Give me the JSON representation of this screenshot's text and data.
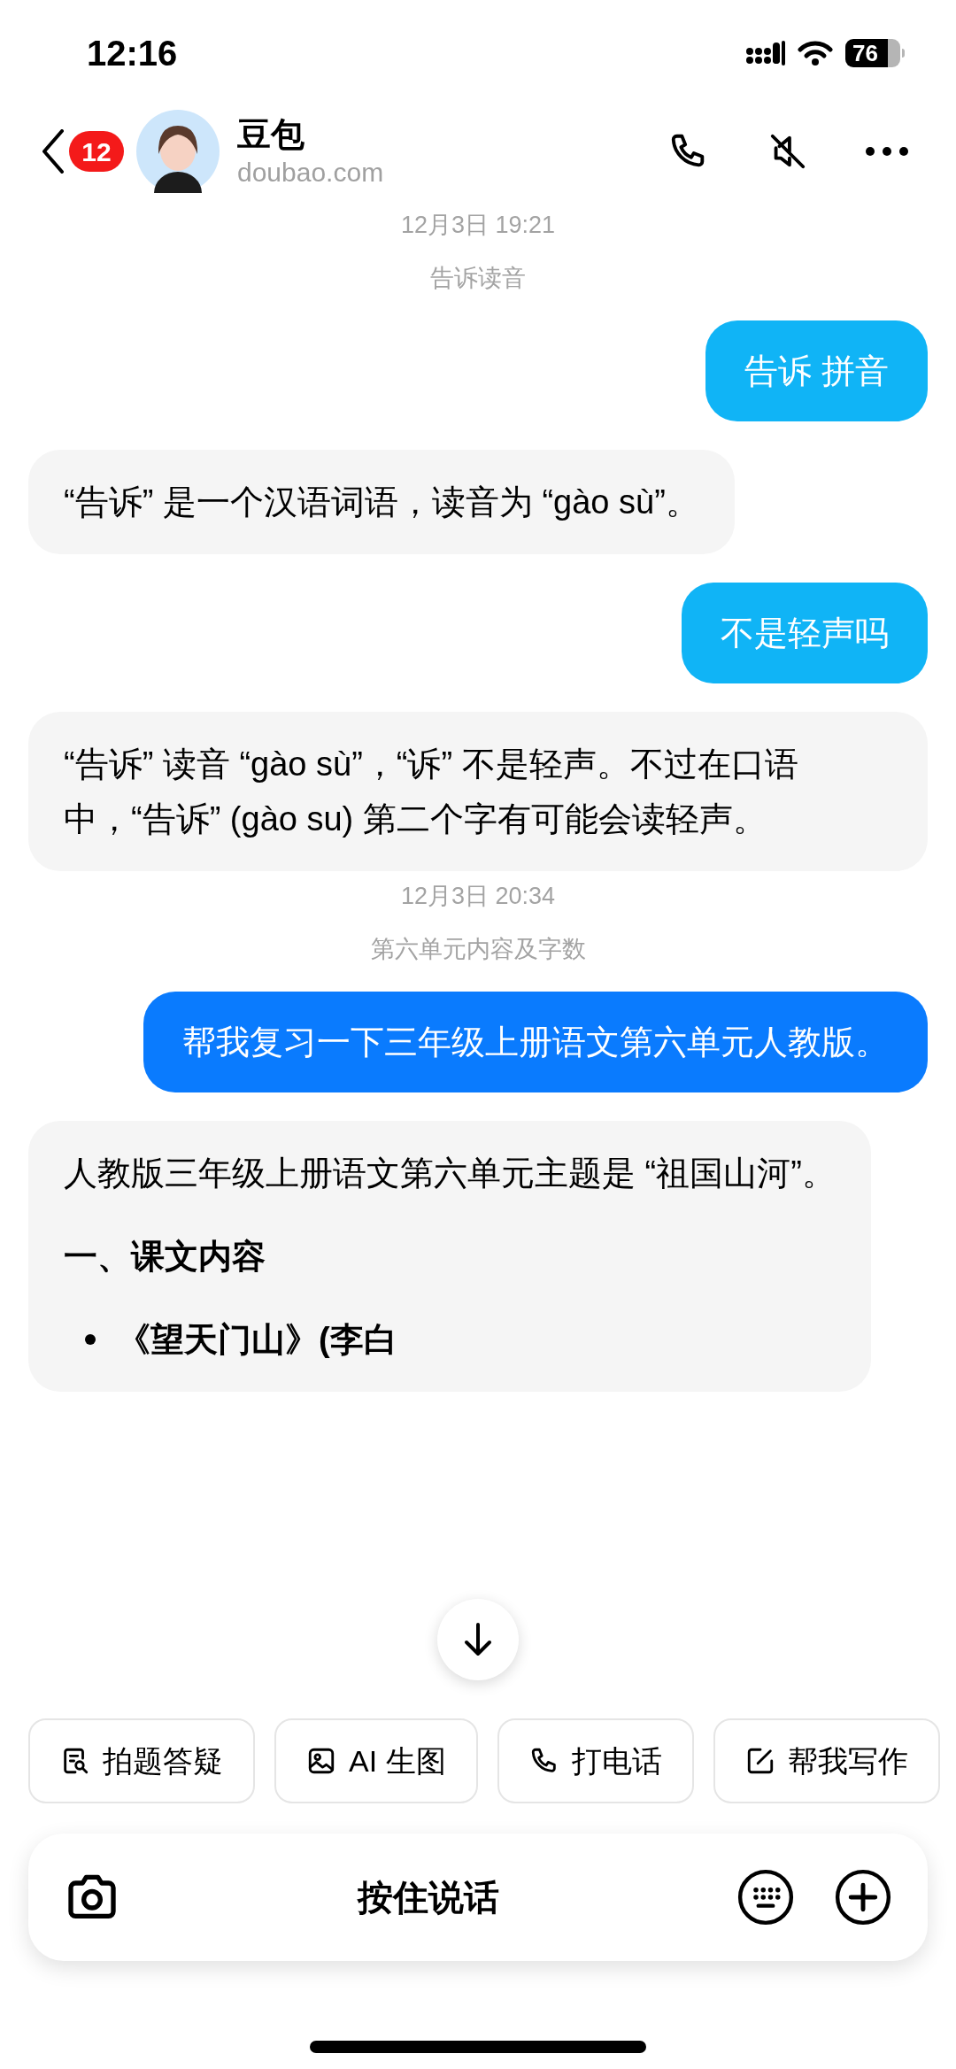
{
  "status_bar": {
    "time": "12:16",
    "battery": "76"
  },
  "header": {
    "unread_badge": "12",
    "name": "豆包",
    "subtitle": "doubao.com"
  },
  "messages": [
    {
      "kind": "timestamp",
      "text": "12月3日 19:21"
    },
    {
      "kind": "topic",
      "text": "告诉读音"
    },
    {
      "kind": "user",
      "text": "告诉 拼音",
      "color": "#10b4f6"
    },
    {
      "kind": "bot",
      "blocks": [
        {
          "kind": "paragraph",
          "text": "“告诉” 是一个汉语词语，读音为 “gào sù”。"
        }
      ]
    },
    {
      "kind": "user",
      "text": "不是轻声吗",
      "color": "#10b4f6"
    },
    {
      "kind": "bot",
      "blocks": [
        {
          "kind": "paragraph",
          "text": "“告诉” 读音 “gào sù”，“诉” 不是轻声。不过在口语中，“告诉” (gào su) 第二个字有可能会读轻声。"
        }
      ]
    },
    {
      "kind": "timestamp",
      "text": "12月3日 20:34"
    },
    {
      "kind": "topic",
      "text": "第六单元内容及字数"
    },
    {
      "kind": "user",
      "text": "帮我复习一下三年级上册语文第六单元人教版。",
      "color": "#0a7bfe"
    },
    {
      "kind": "bot",
      "blocks": [
        {
          "kind": "paragraph",
          "text": "人教版三年级上册语文第六单元主题是 “祖国山河”。"
        },
        {
          "kind": "heading",
          "text": "一、课文内容"
        },
        {
          "kind": "bullet",
          "text": "《望天门山》(李白"
        }
      ]
    }
  ],
  "quick_actions": [
    {
      "kind": "search-doc",
      "label": "拍题答疑"
    },
    {
      "kind": "image",
      "label": "AI 生图"
    },
    {
      "kind": "phone",
      "label": "打电话"
    },
    {
      "kind": "edit",
      "label": "帮我写作"
    }
  ],
  "input_bar": {
    "hold_to_talk": "按住说话"
  }
}
